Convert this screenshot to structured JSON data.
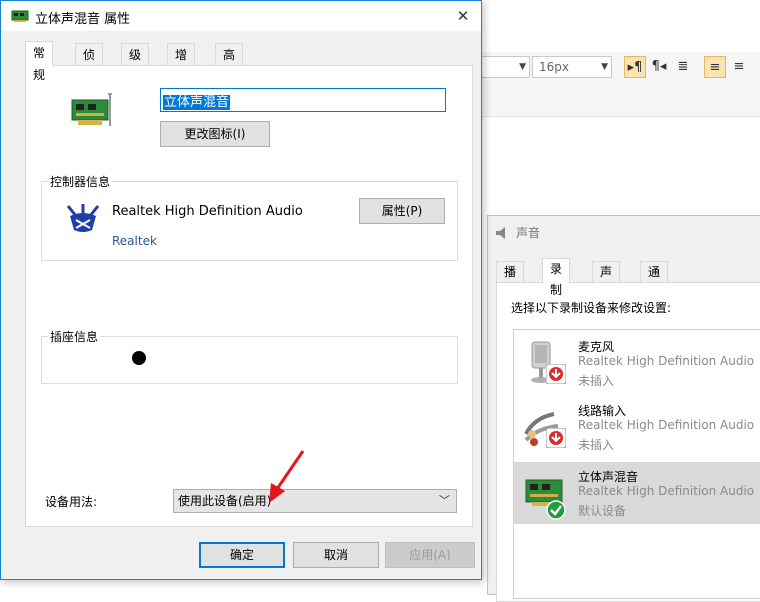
{
  "background_app": {
    "font_size_value": "16px",
    "toolbar_icons": [
      "align-ltr-icon",
      "align-rtl-icon",
      "indent-icon",
      "align-left-icon",
      "align-center-icon"
    ]
  },
  "sound_dialog": {
    "title": "声音",
    "tabs": [
      {
        "label": "播放",
        "active": false
      },
      {
        "label": "录制",
        "active": true
      },
      {
        "label": "声音",
        "active": false
      },
      {
        "label": "通信",
        "active": false
      }
    ],
    "prompt": "选择以下录制设备来修改设置:",
    "devices": [
      {
        "name": "麦克风",
        "driver": "Realtek High Definition Audio",
        "status": "未插入",
        "icon": "microphone-icon",
        "badge": "down-arrow-badge-icon",
        "selected": false
      },
      {
        "name": "线路输入",
        "driver": "Realtek High Definition Audio",
        "status": "未插入",
        "icon": "line-in-icon",
        "badge": "down-arrow-badge-icon",
        "selected": false
      },
      {
        "name": "立体声混音",
        "driver": "Realtek High Definition Audio",
        "status": "默认设备",
        "icon": "sound-card-icon",
        "badge": "check-badge-icon",
        "selected": true
      }
    ]
  },
  "properties_dialog": {
    "title": "立体声混音 属性",
    "tabs": [
      {
        "label": "常规",
        "active": true
      },
      {
        "label": "侦听",
        "active": false
      },
      {
        "label": "级别",
        "active": false
      },
      {
        "label": "增强",
        "active": false
      },
      {
        "label": "高级",
        "active": false
      }
    ],
    "device_name_value": "立体声混音",
    "change_icon_label": "更改图标(I)",
    "controller_group_label": "控制器信息",
    "controller_name": "Realtek High Definition Audio",
    "controller_vendor": "Realtek",
    "controller_props_label": "属性(P)",
    "jack_group_label": "插座信息",
    "usage_label": "设备用法:",
    "usage_value": "使用此设备(启用)",
    "ok_label": "确定",
    "cancel_label": "取消",
    "apply_label": "应用(A)",
    "colors": {
      "accent": "#0078d7",
      "annotation_arrow": "#e8141b",
      "vendor_link": "#2b5797"
    }
  }
}
